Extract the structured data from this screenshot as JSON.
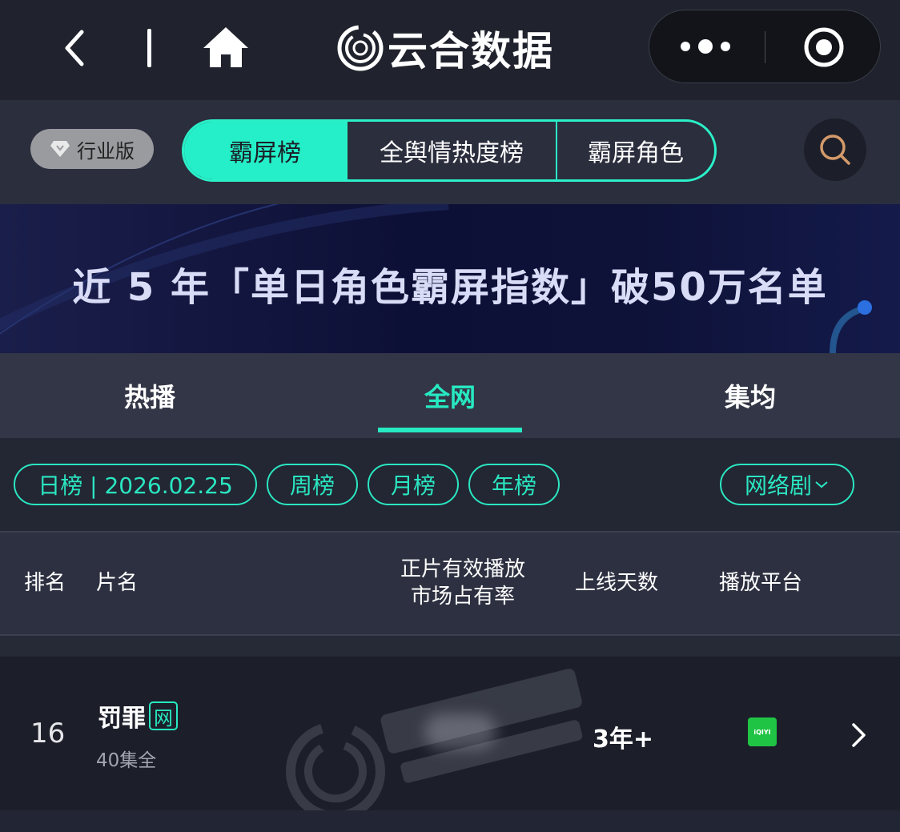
{
  "app": {
    "brand_name": "云合数据",
    "icons": [
      "back-icon",
      "home-icon",
      "brand-logo-icon",
      "more-dots-icon",
      "close-circle-icon"
    ]
  },
  "navbar": {
    "edition_label": "行业版",
    "segments": [
      {
        "label": "霸屏榜",
        "active": true
      },
      {
        "label": "全舆情热度榜",
        "active": false
      },
      {
        "label": "霸屏角色",
        "active": false
      }
    ],
    "search_icon": "search-icon"
  },
  "banner": {
    "text": "近 5 年「单日角色霸屏指数」破50万名单"
  },
  "tabs": [
    {
      "label": "热播",
      "active": false
    },
    {
      "label": "全网",
      "active": true
    },
    {
      "label": "集均",
      "active": false
    }
  ],
  "filters": {
    "daily": "日榜 | 2026.02.25",
    "weekly": "周榜",
    "monthly": "月榜",
    "yearly": "年榜",
    "category": "网络剧"
  },
  "table": {
    "headers": {
      "rank": "排名",
      "title": "片名",
      "share_line1": "正片有效播放",
      "share_line2": "市场占有率",
      "days": "上线天数",
      "platform": "播放平台"
    },
    "rows": [
      {
        "rank": "16",
        "title": "罚罪",
        "badge": "网",
        "episodes": "40集全",
        "days": "3年+",
        "platform": "iQIYI"
      }
    ]
  },
  "colors": {
    "accent": "#27e9c2",
    "background": "#1e212d",
    "topbar": "#20232d",
    "banner": "#0d1036",
    "platform_green": "#20c445"
  }
}
